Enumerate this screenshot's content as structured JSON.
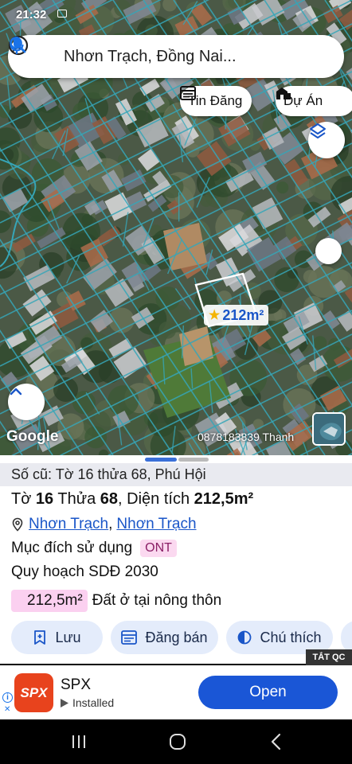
{
  "status_bar": {
    "time": "21:32"
  },
  "search": {
    "query": "Nhơn Trạch, Đồng Nai..."
  },
  "chips": {
    "tin_dang": "Tin Đăng",
    "du_an": "Dự Án"
  },
  "map": {
    "area_label": "212m²",
    "google": "Google",
    "attribution": "0878183839 Thanh",
    "boundary_color": "#36a6b8"
  },
  "parcel": {
    "old_info": "Số cũ: Tờ 16 thửa 68, Phú Hội",
    "to_label": "Tờ",
    "to_value": "16",
    "thua_label": "Thửa",
    "thua_value": "68",
    "area_text": ", Diện tích",
    "area_value": "212,5m²",
    "district": "Nhơn Trạch",
    "ward": "Nhơn Trạch",
    "separator": ",",
    "purpose_label": "Mục đích sử dụng",
    "purpose_code": "ONT",
    "planning": "Quy hoạch SDĐ 2030",
    "land_area": "212,5m²",
    "land_type": "Đất ở tại nông thôn"
  },
  "actions": {
    "save": "Lưu",
    "sell": "Đăng bán",
    "legend": "Chú thích"
  },
  "ad": {
    "close": "TẮT QC",
    "logo": "SPX",
    "name": "SPX",
    "status": "Installed",
    "cta": "Open",
    "accent": "#1a56d6"
  },
  "colors": {
    "accent": "#1a56c8",
    "badge_bg": "#fbd9f0",
    "button_bg": "#e4ecfb"
  }
}
